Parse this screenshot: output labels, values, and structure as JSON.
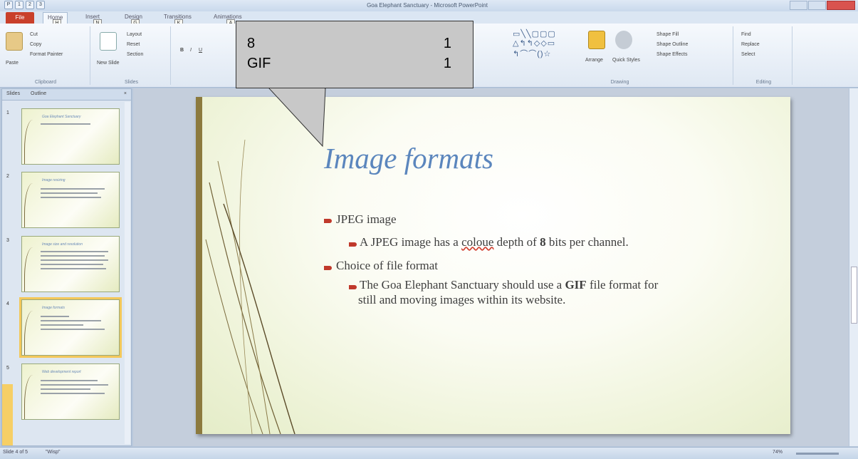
{
  "app": {
    "title": "Goa Elephant Sanctuary - Microsoft PowerPoint"
  },
  "quick_access": [
    "1",
    "2",
    "3"
  ],
  "tabs": [
    {
      "label": "File"
    },
    {
      "label": "Home"
    },
    {
      "label": "Insert"
    },
    {
      "label": "Design"
    },
    {
      "label": "Transitions"
    },
    {
      "label": "Animations"
    }
  ],
  "keytips": [
    "H",
    "N",
    "G",
    "K",
    "A"
  ],
  "ribbon": {
    "clipboard": {
      "group": "Clipboard",
      "paste": "Paste",
      "cut": "Cut",
      "copy": "Copy",
      "format_painter": "Format Painter"
    },
    "slides": {
      "group": "Slides",
      "new_slide": "New Slide",
      "layout": "Layout",
      "reset": "Reset",
      "section": "Section"
    },
    "drawing": {
      "group": "Drawing",
      "arrange": "Arrange",
      "quick_styles": "Quick Styles",
      "shape_fill": "Shape Fill",
      "shape_outline": "Shape Outline",
      "shape_effects": "Shape Effects"
    },
    "editing": {
      "group": "Editing",
      "find": "Find",
      "replace": "Replace",
      "select": "Select"
    }
  },
  "pane": {
    "tab_slides": "Slides",
    "tab_outline": "Outline",
    "close": "×",
    "thumbnails": [
      {
        "num": "1",
        "title": "Goa Elephant Sanctuary"
      },
      {
        "num": "2",
        "title": "Image resizing"
      },
      {
        "num": "3",
        "title": "Image size and resolution"
      },
      {
        "num": "4",
        "title": "Image formats"
      },
      {
        "num": "5",
        "title": "Web development report"
      }
    ]
  },
  "slide": {
    "title": "Image formats",
    "bullet1": "JPEG image",
    "sub1_a": "A JPEG  image has a ",
    "sub1_spell": "coloue",
    "sub1_b": " depth of ",
    "sub1_bold": "8",
    "sub1_c": " bits per channel.",
    "bullet2": "Choice of file format",
    "sub2_a": "The Goa Elephant Sanctuary should use a ",
    "sub2_bold": "GIF",
    "sub2_b": " file format for",
    "sub2_line2": "still and moving images within its website."
  },
  "callout": {
    "rows": [
      {
        "label": "8",
        "value": "1"
      },
      {
        "label": "GIF",
        "value": "1"
      }
    ]
  },
  "status": {
    "slide_info": "Slide 4 of 5",
    "theme": "\"Wisp\"",
    "zoom": "74%"
  },
  "colors": {
    "accent": "#c9402a",
    "title_blue": "#5b86bd",
    "bullet_red": "#c0392b"
  }
}
